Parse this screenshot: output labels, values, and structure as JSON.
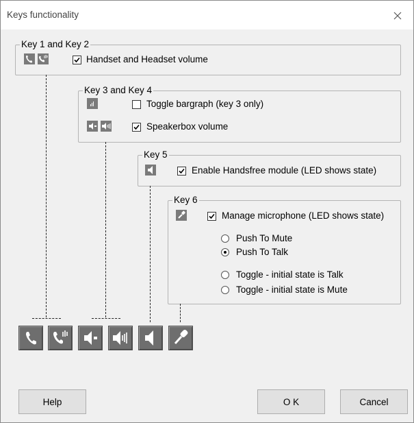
{
  "dialog": {
    "title": "Keys functionality",
    "close_icon": "close-icon"
  },
  "group_key12": {
    "legend": "Key 1 and Key 2",
    "icons": [
      "handset-icon",
      "headset-icon"
    ],
    "option": {
      "label": "Handset and Headset volume",
      "checked": true
    }
  },
  "group_key34": {
    "legend": "Key 3 and Key 4",
    "options": [
      {
        "icon": "bargraph-icon",
        "label": "Toggle bargraph (key 3 only)",
        "checked": false
      },
      {
        "icons": [
          "speaker-volume-down-icon",
          "speaker-volume-up-icon"
        ],
        "label": "Speakerbox volume",
        "checked": true
      }
    ]
  },
  "group_key5": {
    "legend": "Key 5",
    "icon": "speaker-icon",
    "option": {
      "label": "Enable Handsfree module (LED shows state)",
      "checked": true
    }
  },
  "group_key6": {
    "legend": "Key 6",
    "icon": "microphone-icon",
    "option": {
      "label": "Manage microphone (LED shows state)",
      "checked": true
    },
    "radios": [
      {
        "label": "Push To Mute",
        "selected": false
      },
      {
        "label": "Push To Talk",
        "selected": true
      },
      {
        "label": "Toggle - initial state is Talk",
        "selected": false
      },
      {
        "label": "Toggle - initial state is Mute",
        "selected": false
      }
    ]
  },
  "key_buttons": [
    "handset-icon",
    "headset-icon",
    "speaker-volume-down-icon",
    "speaker-volume-up-icon",
    "speaker-icon",
    "microphone-icon"
  ],
  "buttons": {
    "help": "Help",
    "ok": "O K",
    "cancel": "Cancel"
  }
}
